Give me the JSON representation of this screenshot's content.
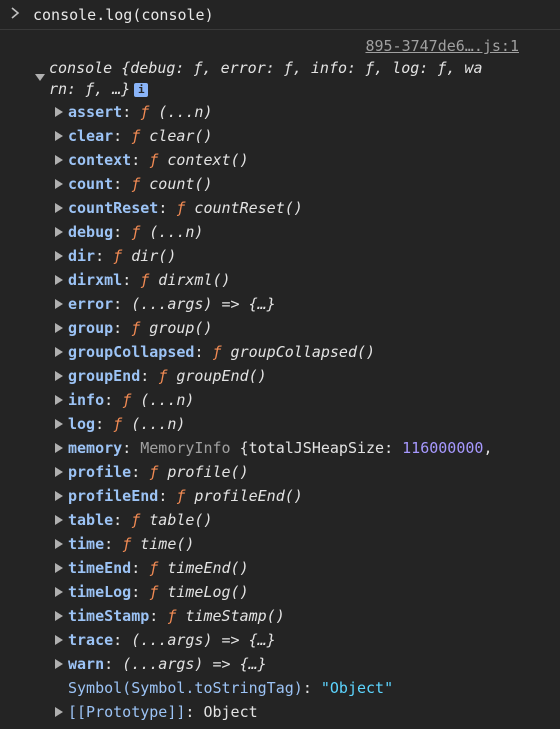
{
  "console_input": {
    "command": "console.log(console)"
  },
  "source": {
    "link": "895-3747de6….js:1"
  },
  "log_object": {
    "summary_line1": "console {debug: ƒ, error: ƒ, info: ƒ, log: ƒ, wa",
    "summary_line2": "rn: ƒ, …}",
    "info_badge": "i"
  },
  "properties": [
    {
      "key": "assert",
      "sep": ": ",
      "f": "ƒ",
      "value": " (...n)"
    },
    {
      "key": "clear",
      "sep": ": ",
      "f": "ƒ",
      "value": " clear()"
    },
    {
      "key": "context",
      "sep": ": ",
      "f": "ƒ",
      "value": " context()"
    },
    {
      "key": "count",
      "sep": ": ",
      "f": "ƒ",
      "value": " count()"
    },
    {
      "key": "countReset",
      "sep": ": ",
      "f": "ƒ",
      "value": " countReset()"
    },
    {
      "key": "debug",
      "sep": ": ",
      "f": "ƒ",
      "value": " (...n)"
    },
    {
      "key": "dir",
      "sep": ": ",
      "f": "ƒ",
      "value": " dir()"
    },
    {
      "key": "dirxml",
      "sep": ": ",
      "f": "ƒ",
      "value": " dirxml()"
    },
    {
      "key": "error",
      "sep": ": ",
      "f": "",
      "value": "(...args) => {…}"
    },
    {
      "key": "group",
      "sep": ": ",
      "f": "ƒ",
      "value": " group()"
    },
    {
      "key": "groupCollapsed",
      "sep": ": ",
      "f": "ƒ",
      "value": " groupCollapsed()"
    },
    {
      "key": "groupEnd",
      "sep": ": ",
      "f": "ƒ",
      "value": " groupEnd()"
    },
    {
      "key": "info",
      "sep": ": ",
      "f": "ƒ",
      "value": " (...n)"
    },
    {
      "key": "log",
      "sep": ": ",
      "f": "ƒ",
      "value": " (...n)"
    },
    {
      "key": "memory",
      "sep": ": ",
      "f": "",
      "type": "MemoryInfo",
      "value": " {totalJSHeapSize: ",
      "number": "116000000",
      "tail": ","
    },
    {
      "key": "profile",
      "sep": ": ",
      "f": "ƒ",
      "value": " profile()"
    },
    {
      "key": "profileEnd",
      "sep": ": ",
      "f": "ƒ",
      "value": " profileEnd()"
    },
    {
      "key": "table",
      "sep": ": ",
      "f": "ƒ",
      "value": " table()"
    },
    {
      "key": "time",
      "sep": ": ",
      "f": "ƒ",
      "value": " time()"
    },
    {
      "key": "timeEnd",
      "sep": ": ",
      "f": "ƒ",
      "value": " timeEnd()"
    },
    {
      "key": "timeLog",
      "sep": ": ",
      "f": "ƒ",
      "value": " timeLog()"
    },
    {
      "key": "timeStamp",
      "sep": ": ",
      "f": "ƒ",
      "value": " timeStamp()"
    },
    {
      "key": "trace",
      "sep": ": ",
      "f": "",
      "value": "(...args) => {…}"
    },
    {
      "key": "warn",
      "sep": ": ",
      "f": "",
      "value": "(...args) => {…}"
    },
    {
      "key": "Symbol(Symbol.toStringTag)",
      "sep": ": ",
      "string": "\"Object\""
    },
    {
      "key": "[[Prototype]]",
      "sep": ": ",
      "value": "Object"
    }
  ],
  "colors": {
    "background": "#242424",
    "key": "#9cc3f5",
    "function_f": "#f28b54",
    "number": "#a799ff",
    "string": "#5cd5ff",
    "dim": "#a0a0a0"
  },
  "icons": [
    "chevron-right-prompt-icon",
    "disclosure-open-icon",
    "disclosure-closed-icon",
    "info-badge-icon"
  ]
}
